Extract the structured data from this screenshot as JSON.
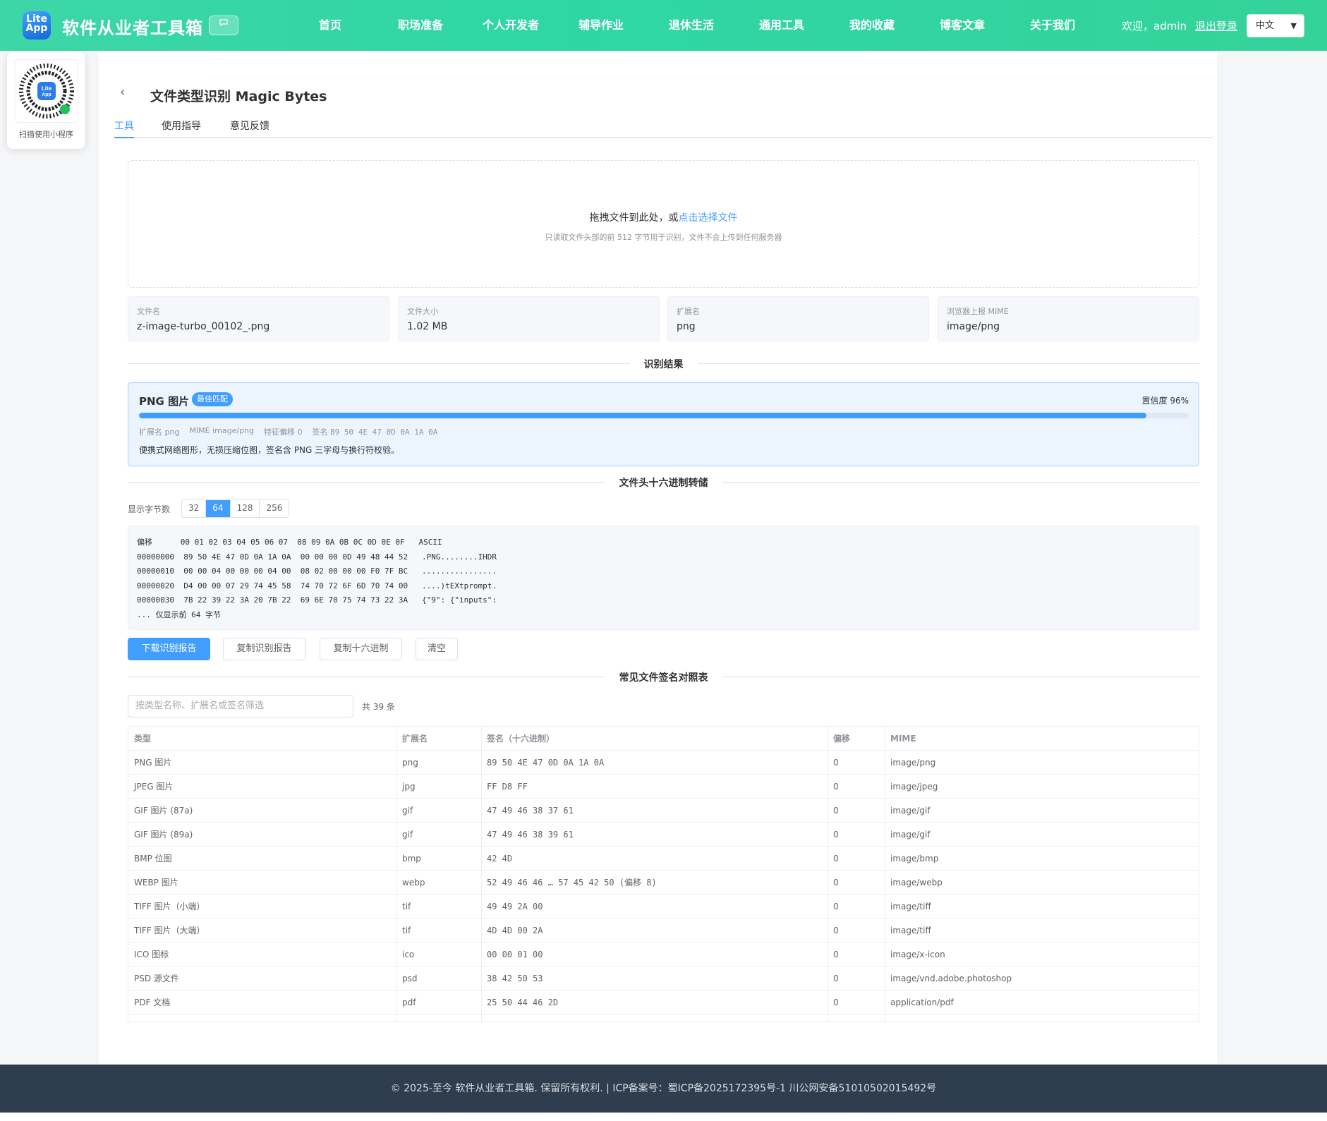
{
  "header": {
    "logo_text": "Lite App",
    "brand": "软件从业者工具箱",
    "nav": [
      "首页",
      "职场准备",
      "个人开发者",
      "辅导作业",
      "退休生活",
      "通用工具",
      "我的收藏",
      "博客文章",
      "关于我们"
    ],
    "welcome": "欢迎，admin",
    "logout": "退出登录",
    "language": "中文"
  },
  "qr": {
    "caption": "扫描使用小程序"
  },
  "page": {
    "title": "文件类型识别 Magic Bytes",
    "tabs": [
      "工具",
      "使用指导",
      "意见反馈"
    ],
    "active_tab": "工具"
  },
  "drop": {
    "prompt": "拖拽文件到此处，或",
    "link": "点击选择文件",
    "hint": "只读取文件头部的前 512 字节用于识别，文件不会上传到任何服务器"
  },
  "file_info": [
    {
      "label": "文件名",
      "value": "z-image-turbo_00102_.png"
    },
    {
      "label": "文件大小",
      "value": "1.02 MB"
    },
    {
      "label": "扩展名",
      "value": "png"
    },
    {
      "label": "浏览器上报 MIME",
      "value": "image/png"
    }
  ],
  "result_section": "识别结果",
  "result": {
    "name": "PNG 图片",
    "badge": "最佳匹配",
    "confidence_text": "置信度 96%",
    "confidence": 0.96,
    "ext": "扩展名 png",
    "mime": "MIME image/png",
    "offset": "特征偏移 0",
    "sig_label": "签名",
    "signature": "89 50 4E 47 0D 0A 1A 0A",
    "description": "便携式网络图形，无损压缩位图，签名含 PNG 三字母与换行符校验。"
  },
  "hex_section": "文件头十六进制转储",
  "hex": {
    "bytes_label": "显示字节数",
    "options": [
      "32",
      "64",
      "128",
      "256"
    ],
    "selected": "64",
    "lines": [
      "偏移      00 01 02 03 04 05 06 07  08 09 0A 0B 0C 0D 0E 0F   ASCII",
      "00000000  89 50 4E 47 0D 0A 1A 0A  00 00 00 0D 49 48 44 52   .PNG........IHDR",
      "00000010  00 00 04 00 00 00 04 00  08 02 00 00 00 F0 7F BC   ................",
      "00000020  D4 00 00 07 29 74 45 58  74 70 72 6F 6D 70 74 00   ....)tEXtprompt.",
      "00000030  7B 22 39 22 3A 20 7B 22  69 6E 70 75 74 73 22 3A   {\"9\": {\"inputs\":",
      "... 仅显示前 64 字节"
    ]
  },
  "buttons": {
    "download": "下载识别报告",
    "copy_report": "复制识别报告",
    "copy_hex": "复制十六进制",
    "clear": "清空"
  },
  "table_section": "常见文件签名对照表",
  "filter": {
    "placeholder": "按类型名称、扩展名或签名筛选",
    "count": "共 39 条"
  },
  "table": {
    "headers": [
      "类型",
      "扩展名",
      "签名（十六进制）",
      "偏移",
      "MIME"
    ],
    "rows": [
      [
        "PNG 图片",
        "png",
        "89 50 4E 47 0D 0A 1A 0A",
        "0",
        "image/png"
      ],
      [
        "JPEG 图片",
        "jpg",
        "FF D8 FF",
        "0",
        "image/jpeg"
      ],
      [
        "GIF 图片 (87a)",
        "gif",
        "47 49 46 38 37 61",
        "0",
        "image/gif"
      ],
      [
        "GIF 图片 (89a)",
        "gif",
        "47 49 46 38 39 61",
        "0",
        "image/gif"
      ],
      [
        "BMP 位图",
        "bmp",
        "42 4D",
        "0",
        "image/bmp"
      ],
      [
        "WEBP 图片",
        "webp",
        "52 49 46 46 … 57 45 42 50 (偏移 8)",
        "0",
        "image/webp"
      ],
      [
        "TIFF 图片（小端）",
        "tif",
        "49 49 2A 00",
        "0",
        "image/tiff"
      ],
      [
        "TIFF 图片（大端）",
        "tif",
        "4D 4D 00 2A",
        "0",
        "image/tiff"
      ],
      [
        "ICO 图标",
        "ico",
        "00 00 01 00",
        "0",
        "image/x-icon"
      ],
      [
        "PSD 源文件",
        "psd",
        "38 42 50 53",
        "0",
        "image/vnd.adobe.photoshop"
      ],
      [
        "PDF 文档",
        "pdf",
        "25 50 44 46 2D",
        "0",
        "application/pdf"
      ]
    ]
  },
  "footer": "© 2025-至今 软件从业者工具箱. 保留所有权利.  |  ICP备案号：蜀ICP备2025172395号-1   川公网安备51010502015492号",
  "colors": {
    "header": "#34d6a2",
    "accent": "#409eff",
    "footer": "#2f3e4e"
  }
}
